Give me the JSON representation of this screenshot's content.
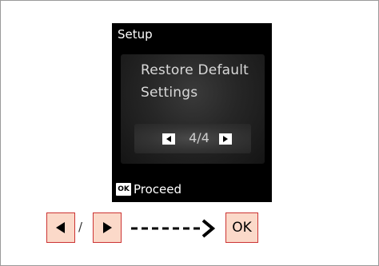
{
  "screen": {
    "title": "Setup",
    "lines": [
      "Restore Default",
      "Settings"
    ],
    "page_indicator": "4/4",
    "footer_key": "OK",
    "footer_label": "Proceed"
  },
  "sequence": {
    "separator": "/",
    "ok_label": "OK"
  },
  "colors": {
    "key_fill": "#fbd9c9",
    "key_border": "#cc3333",
    "lcd_background": "#000000"
  },
  "icons": [
    "left-arrow-icon",
    "right-arrow-icon",
    "dashed-arrow-icon"
  ]
}
